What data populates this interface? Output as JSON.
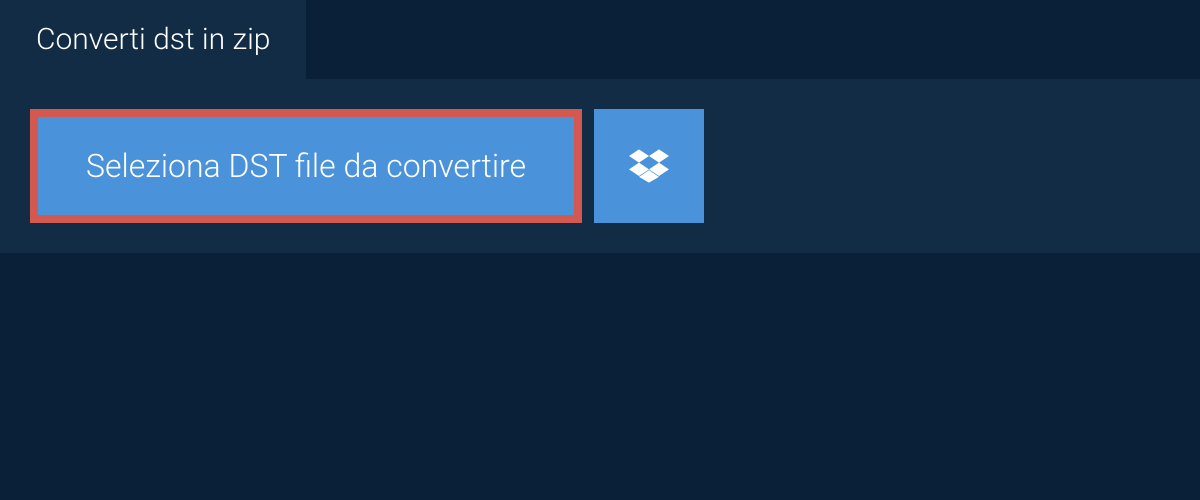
{
  "tab": {
    "title": "Converti dst in zip"
  },
  "actions": {
    "select_file_label": "Seleziona DST file da convertire"
  },
  "colors": {
    "background": "#0a2038",
    "panel": "#112c44",
    "button": "#4a92d9",
    "highlight_border": "#d3584f"
  }
}
